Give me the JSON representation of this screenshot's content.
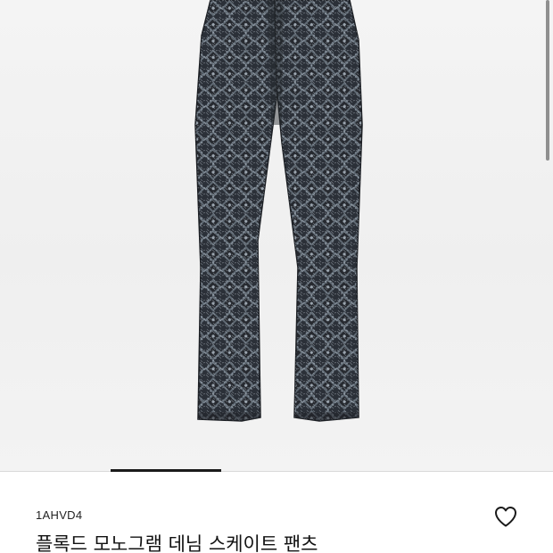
{
  "product": {
    "code": "1AHVD4",
    "title": "플록드 모노그램 데님 스케이트 팬츠",
    "image_subject": "monogram denim pants"
  },
  "gallery": {
    "active_index": 2
  },
  "icons": {
    "wishlist": "heart-outline-icon"
  },
  "colors": {
    "background": "#ffffff",
    "gallery_bg": "#f2f2f2",
    "denim_dark": "#2a2f37",
    "denim_light": "#8e98a2",
    "indicator": "#1a1a1a",
    "text": "#111111"
  }
}
